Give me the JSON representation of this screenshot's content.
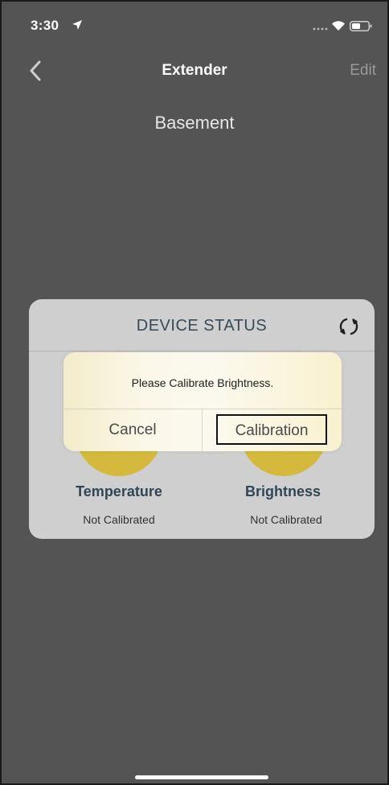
{
  "status_bar": {
    "time": "3:30",
    "icons": [
      "location-arrow-icon",
      "signal-dots-icon",
      "wifi-icon",
      "battery-icon"
    ]
  },
  "nav": {
    "back_icon": "chevron-left-icon",
    "title": "Extender",
    "edit_label": "Edit"
  },
  "device": {
    "name": "Basement"
  },
  "device_status": {
    "title": "DEVICE STATUS",
    "refresh_icon": "refresh-icon",
    "sensors": [
      {
        "label": "Temperature",
        "status": "Not Calibrated"
      },
      {
        "label": "Brightness",
        "status": "Not Calibrated"
      }
    ]
  },
  "alert": {
    "message": "Please Calibrate Brightness.",
    "cancel_label": "Cancel",
    "calibration_label": "Calibration"
  },
  "colors": {
    "background": "#545454",
    "card": "#cfcfcf",
    "sensor_circle": "#d4b93c",
    "label_text": "#2f4755",
    "alert_bg": "#fbf8ea"
  }
}
